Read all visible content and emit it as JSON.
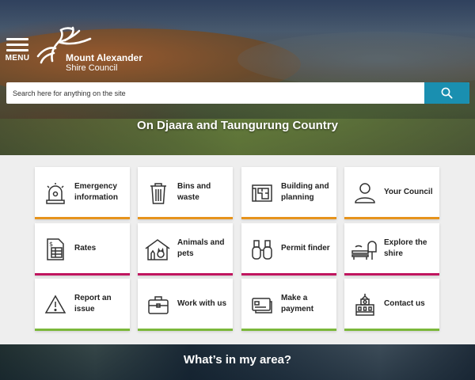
{
  "header": {
    "menu_label": "MENU",
    "logo_line1": "Mount Alexander",
    "logo_line2": "Shire Council"
  },
  "search": {
    "placeholder": "Search here for anything on the site"
  },
  "hero_caption": "On Djaara and Taungurung Country",
  "tiles": [
    {
      "label": "Emergency information",
      "icon": "siren-icon",
      "accent": "#e6931c"
    },
    {
      "label": "Bins and waste",
      "icon": "bin-icon",
      "accent": "#e6931c"
    },
    {
      "label": "Building and planning",
      "icon": "blueprint-icon",
      "accent": "#e6931c"
    },
    {
      "label": "Your Council",
      "icon": "person-icon",
      "accent": "#e6931c"
    },
    {
      "label": "Rates",
      "icon": "rates-document-icon",
      "accent": "#c0155f"
    },
    {
      "label": "Animals and pets",
      "icon": "animal-shelter-icon",
      "accent": "#c0155f"
    },
    {
      "label": "Permit finder",
      "icon": "binoculars-icon",
      "accent": "#c0155f"
    },
    {
      "label": "Explore the shire",
      "icon": "park-bench-icon",
      "accent": "#c0155f"
    },
    {
      "label": "Report an issue",
      "icon": "warning-icon",
      "accent": "#7bb83a"
    },
    {
      "label": "Work with us",
      "icon": "briefcase-icon",
      "accent": "#7bb83a"
    },
    {
      "label": "Make a payment",
      "icon": "payment-card-icon",
      "accent": "#7bb83a"
    },
    {
      "label": "Contact us",
      "icon": "town-hall-icon",
      "accent": "#7bb83a"
    }
  ],
  "area_heading": "What’s in my area?"
}
